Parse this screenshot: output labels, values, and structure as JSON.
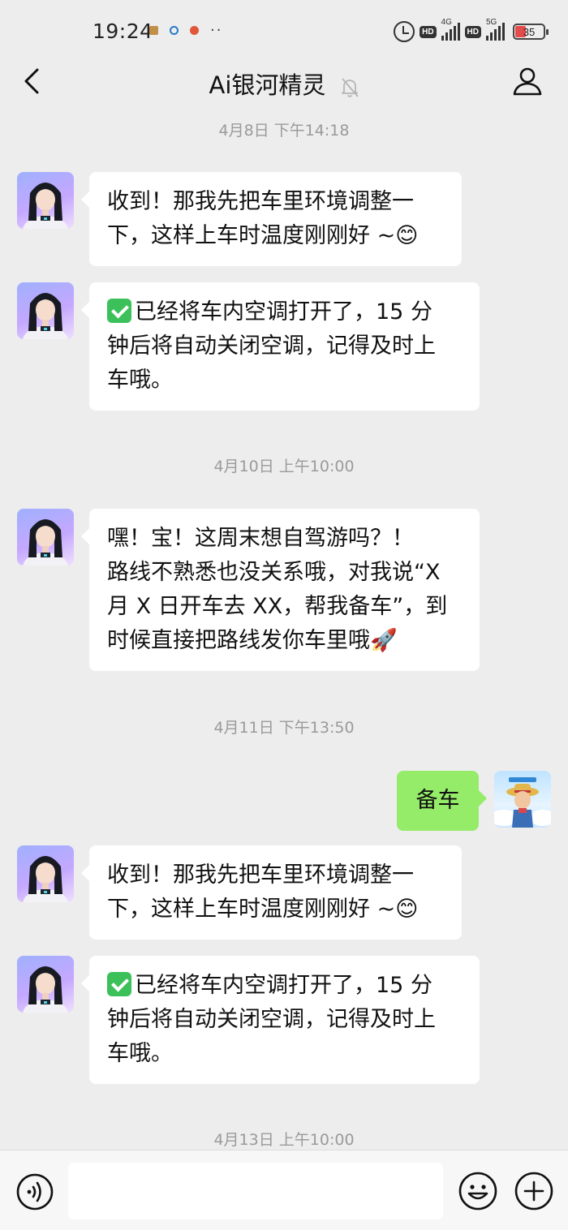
{
  "status_bar": {
    "time": "19:24",
    "network_1": "4G",
    "network_2": "5G",
    "hd_1": "HD",
    "hd_2": "HD",
    "battery": "35"
  },
  "header": {
    "title": "Ai银河精灵",
    "back_icon": "chevron-left-icon",
    "mute_icon": "bell-off-icon",
    "profile_icon": "person-icon"
  },
  "chat": {
    "timestamps": [
      "4月8日 下午14:18",
      "4月10日 上午10:00",
      "4月11日 下午13:50",
      "4月13日 上午10:00"
    ],
    "messages": [
      {
        "sender": "bot",
        "lines": [
          "收到！那我先把车里环境调整一",
          "下，这样上车时温度刚刚好 ~😊"
        ]
      },
      {
        "sender": "bot",
        "check": true,
        "lines": [
          "已经将车内空调打开了，15 分",
          "钟后将自动关闭空调，记得及时上",
          "车哦。"
        ]
      },
      {
        "sender": "bot",
        "lines": [
          "嘿！宝！这周末想自驾游吗？！",
          "路线不熟悉也没关系哦，对我说“X",
          "月 X 日开车去 XX，帮我备车”，到",
          "时候直接把路线发你车里哦🚀"
        ]
      },
      {
        "sender": "me",
        "lines": [
          "备车"
        ]
      },
      {
        "sender": "bot",
        "lines": [
          "收到！那我先把车里环境调整一",
          "下，这样上车时温度刚刚好 ~😊"
        ]
      },
      {
        "sender": "bot",
        "check": true,
        "lines": [
          "已经将车内空调打开了，15 分",
          "钟后将自动关闭空调，记得及时上",
          "车哦。"
        ]
      }
    ]
  },
  "input_bar": {
    "voice_icon": "voice-icon",
    "input_value": "",
    "emoji_icon": "smiley-icon",
    "plus_icon": "plus-circle-icon"
  },
  "colors": {
    "background": "#ededed",
    "bubble_incoming": "#ffffff",
    "bubble_outgoing": "#95ec69",
    "timestamp": "#9a9a9a"
  }
}
